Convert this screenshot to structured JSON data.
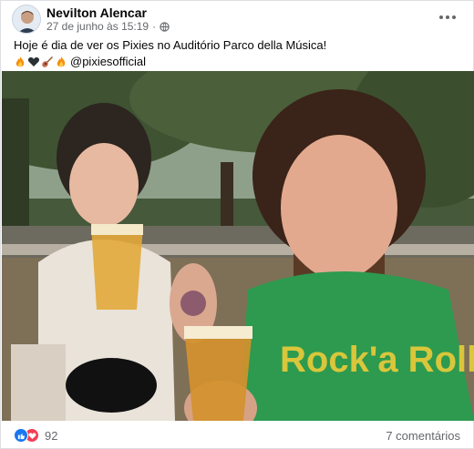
{
  "post": {
    "author": "Nevilton Alencar",
    "timestamp": "27 de junho às 15:19",
    "separator": "·",
    "privacy_icon": "globe-icon",
    "caption_line1": "Hoje é dia de ver os Pixies no Auditório Parco della Música!",
    "caption_emojis": [
      "fire-emoji",
      "black-heart-emoji",
      "guitar-emoji",
      "fire-emoji"
    ],
    "mention": "@pixiesofficial",
    "photo_shirt_text": "Rock'a Rolla"
  },
  "footer": {
    "reaction_icons": [
      "like-icon",
      "love-icon"
    ],
    "reaction_count": "92",
    "comments_label": "7 comentários"
  },
  "colors": {
    "accent": "#1877f2",
    "love": "#f33e58",
    "secondary_text": "#65676b"
  }
}
